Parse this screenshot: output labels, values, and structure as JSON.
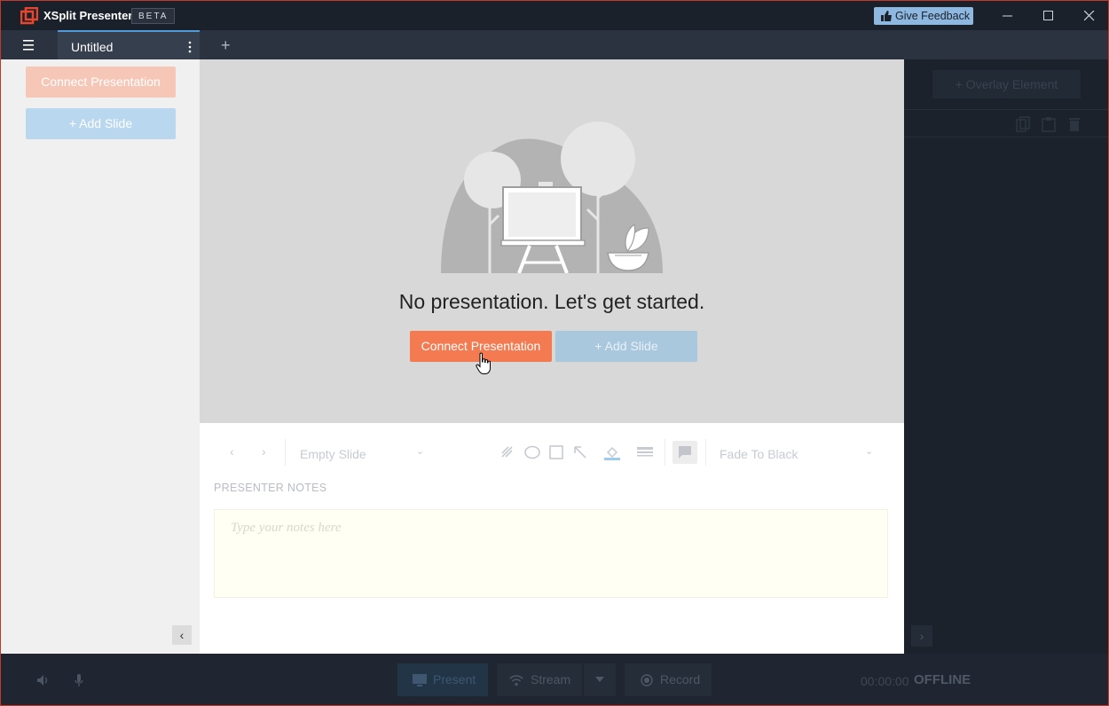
{
  "titlebar": {
    "app_title": "XSplit Presenter",
    "beta_badge": "BETA",
    "feedback_label": "Give Feedback"
  },
  "tabs": {
    "items": [
      {
        "label": "Untitled"
      }
    ],
    "add_label": "+"
  },
  "left_panel": {
    "connect_label": "Connect Presentation",
    "add_slide_label": "+ Add Slide"
  },
  "canvas": {
    "message": "No presentation. Let's get started.",
    "connect_label": "Connect Presentation",
    "add_slide_label": "+ Add Slide"
  },
  "editor": {
    "slide_select": "Empty Slide",
    "transition_select": "Fade To Black",
    "notes_title": "PRESENTER NOTES",
    "notes_placeholder": "Type your notes here"
  },
  "right_panel": {
    "overlay_label": "+ Overlay Element"
  },
  "bottom_bar": {
    "present_label": "Present",
    "stream_label": "Stream",
    "record_label": "Record",
    "timer": "00:00:00",
    "status": "OFFLINE"
  },
  "colors": {
    "accent_orange": "#f47b51",
    "accent_blue": "#4f9ad8",
    "feedback_bg": "#8fb8e0",
    "titlebar_bg": "#1b212b",
    "canvas_bg": "#d8d8d8"
  }
}
